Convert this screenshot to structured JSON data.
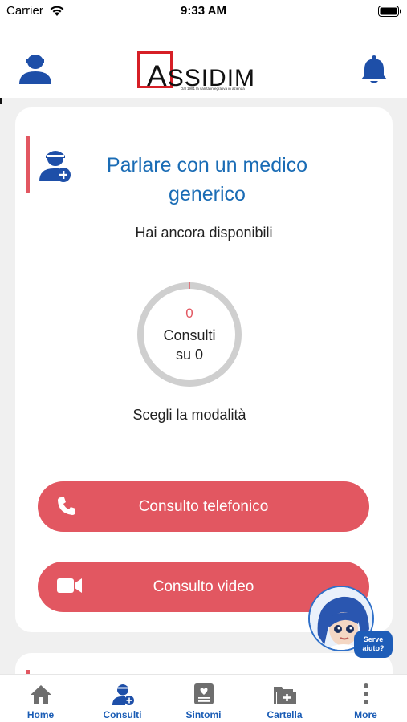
{
  "status_bar": {
    "carrier": "Carrier",
    "time": "9:33 AM"
  },
  "header": {
    "logo_text_first": "A",
    "logo_text_rest": "SSIDIM",
    "logo_tagline": "Dal 1981 la sanità integrativa in azienda"
  },
  "card": {
    "title": "Parlare con un medico generico",
    "available_label": "Hai ancora disponibili",
    "consults_count": "0",
    "consults_label": "Consulti",
    "consults_total": "su 0",
    "consults_used_fraction": 0,
    "mode_label": "Scegli la modalità",
    "phone_button": "Consulto telefonico",
    "video_button": "Consulto video"
  },
  "assistant": {
    "badge_line1": "Serve",
    "badge_line2": "aiuto?"
  },
  "tabbar": {
    "items": [
      {
        "label": "Home",
        "icon": "home-icon"
      },
      {
        "label": "Consulti",
        "icon": "consulti-icon"
      },
      {
        "label": "Sintomi",
        "icon": "sintomi-icon"
      },
      {
        "label": "Cartella",
        "icon": "cartella-icon"
      },
      {
        "label": "More",
        "icon": "more-icon"
      }
    ]
  },
  "colors": {
    "accent_red": "#e25761",
    "brand_blue": "#1a6cb5",
    "tab_blue": "#1a5cb5",
    "icon_blue": "#1e4fa8",
    "tab_grey": "#6e6e6e"
  }
}
